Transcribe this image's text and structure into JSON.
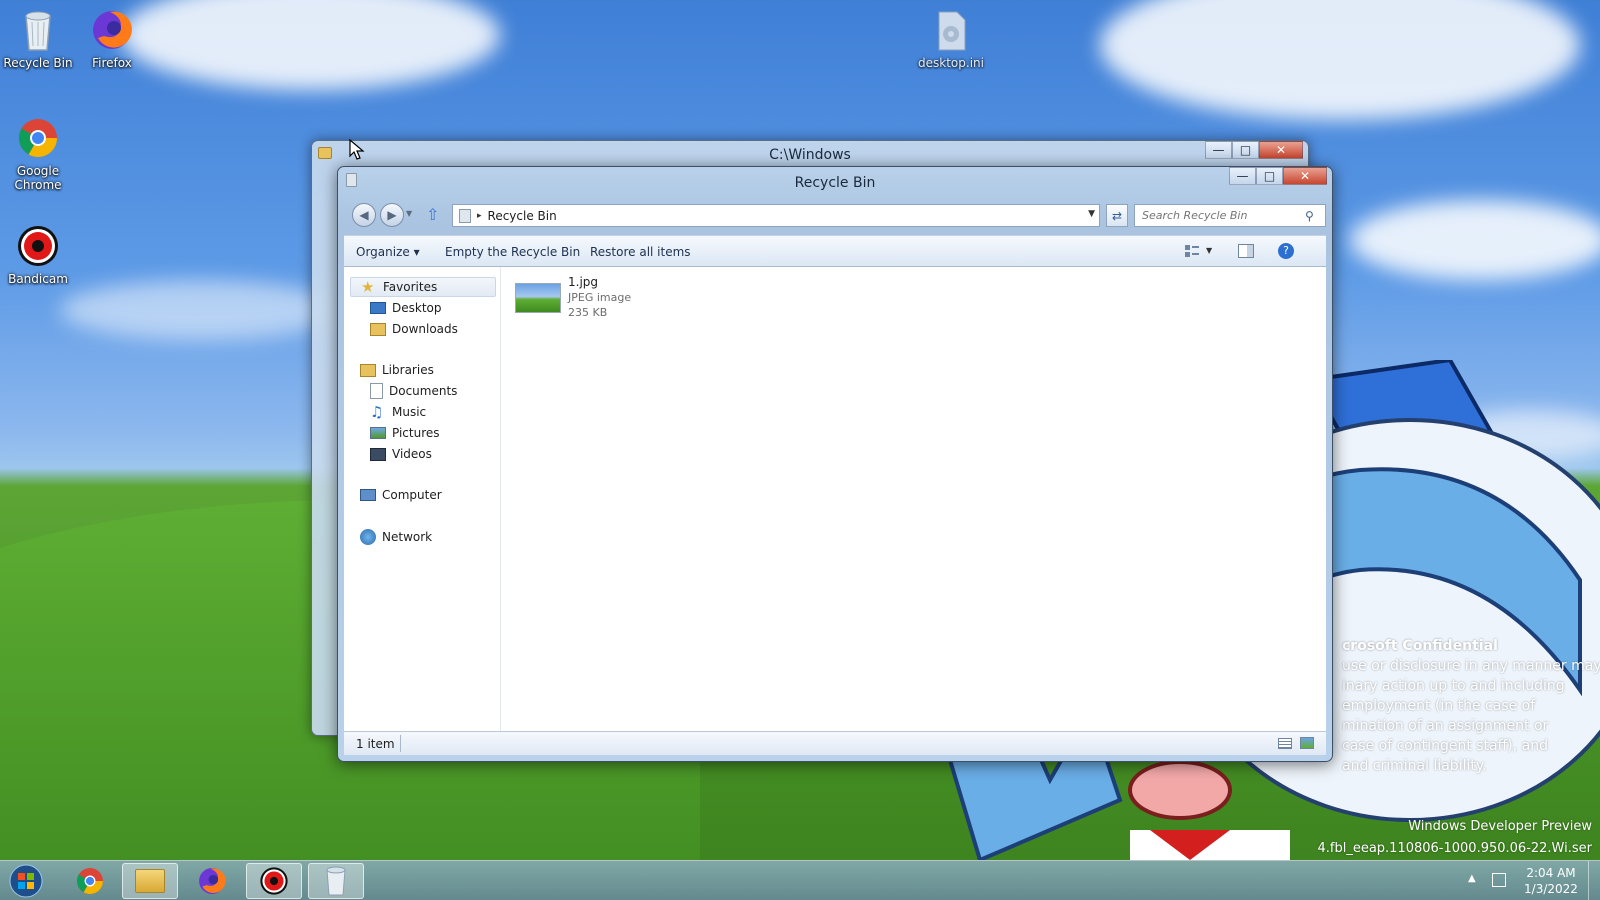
{
  "desktop": {
    "icons": [
      {
        "label": "Recycle Bin"
      },
      {
        "label": "Firefox"
      },
      {
        "label": "Google\nChrome"
      },
      {
        "label": "Bandicam"
      },
      {
        "label": "desktop.ini"
      }
    ],
    "watermark": {
      "confidential_title": "crosoft Confidential",
      "confidential_lines": [
        "use or disclosure in any manner may",
        "inary action up to and including",
        "employment (in the case of",
        "mination of an assignment or",
        "case of contingent staff), and",
        "and criminal liability."
      ],
      "build_title": "Windows Developer Preview",
      "build_string": "4.fbl_eeap.110806-1000.950.06-22.Wi.ser"
    }
  },
  "back_window": {
    "title": "C:\\Windows"
  },
  "front_window": {
    "title": "Recycle Bin",
    "address": {
      "crumb_separator": "▸",
      "location": "Recycle Bin"
    },
    "search": {
      "placeholder": "Search Recycle Bin"
    },
    "toolbar": {
      "organize": "Organize ▾",
      "empty": "Empty the Recycle Bin",
      "restore": "Restore all items"
    },
    "nav": {
      "favorites": {
        "label": "Favorites",
        "items": [
          "Desktop",
          "Downloads"
        ]
      },
      "libraries": {
        "label": "Libraries",
        "items": [
          "Documents",
          "Music",
          "Pictures",
          "Videos"
        ]
      },
      "computer": "Computer",
      "network": "Network"
    },
    "files": [
      {
        "name": "1.jpg",
        "type": "JPEG image",
        "size": "235 KB"
      }
    ],
    "status": "1 item"
  },
  "taskbar": {
    "time": "2:04 AM",
    "date": "1/3/2022"
  },
  "colors": {
    "window_frame": "#b9d1ea",
    "toolbar_text": "#1e3150",
    "close_button": "#c7462f"
  }
}
